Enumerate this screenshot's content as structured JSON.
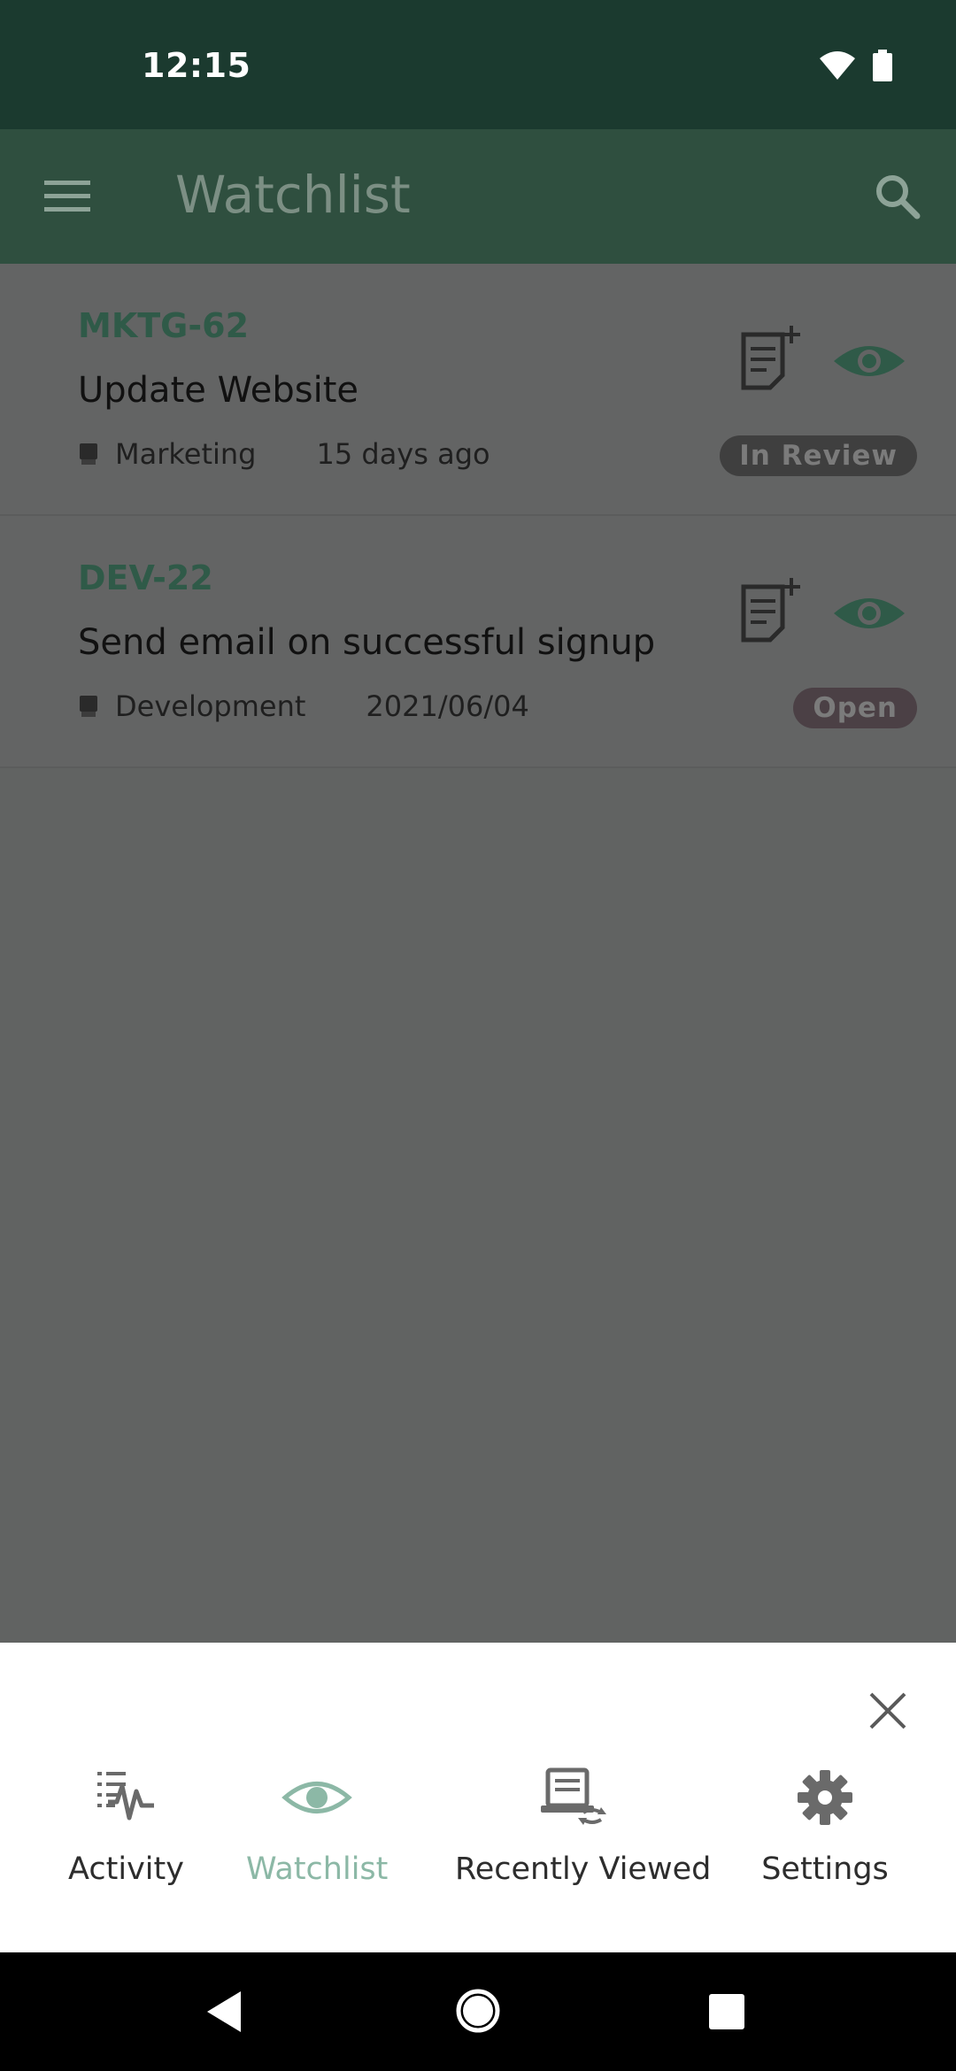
{
  "status_bar": {
    "time": "12:15",
    "icons": [
      "wifi-icon",
      "battery-icon"
    ]
  },
  "app_bar": {
    "title": "Watchlist",
    "menu_icon": "hamburger-menu-icon",
    "search_icon": "search-icon"
  },
  "issues": [
    {
      "key": "MKTG-62",
      "title": "Update Website",
      "project": "Marketing",
      "date": "15 days ago",
      "status": "In Review"
    },
    {
      "key": "DEV-22",
      "title": "Send email on successful signup",
      "project": "Development",
      "date": "2021/06/04",
      "status": "Open"
    }
  ],
  "bottom_sheet": {
    "close_icon": "close-icon",
    "items": [
      {
        "label": "Activity",
        "icon": "activity-icon",
        "active": false
      },
      {
        "label": "Watchlist",
        "icon": "eye-icon",
        "active": true
      },
      {
        "label": "Recently Viewed",
        "icon": "recently-viewed-icon",
        "active": false
      },
      {
        "label": "Settings",
        "icon": "gear-icon",
        "active": false
      }
    ]
  },
  "system_nav": {
    "icons": [
      "back-icon",
      "home-icon",
      "recents-icon"
    ]
  },
  "colors": {
    "status_bar_bg": "#1b3a2f",
    "app_bar_bg": "#2f4f3f",
    "accent": "#2f5a48",
    "active_nav": "#8cb8a6",
    "scrim_content": "#616362"
  }
}
